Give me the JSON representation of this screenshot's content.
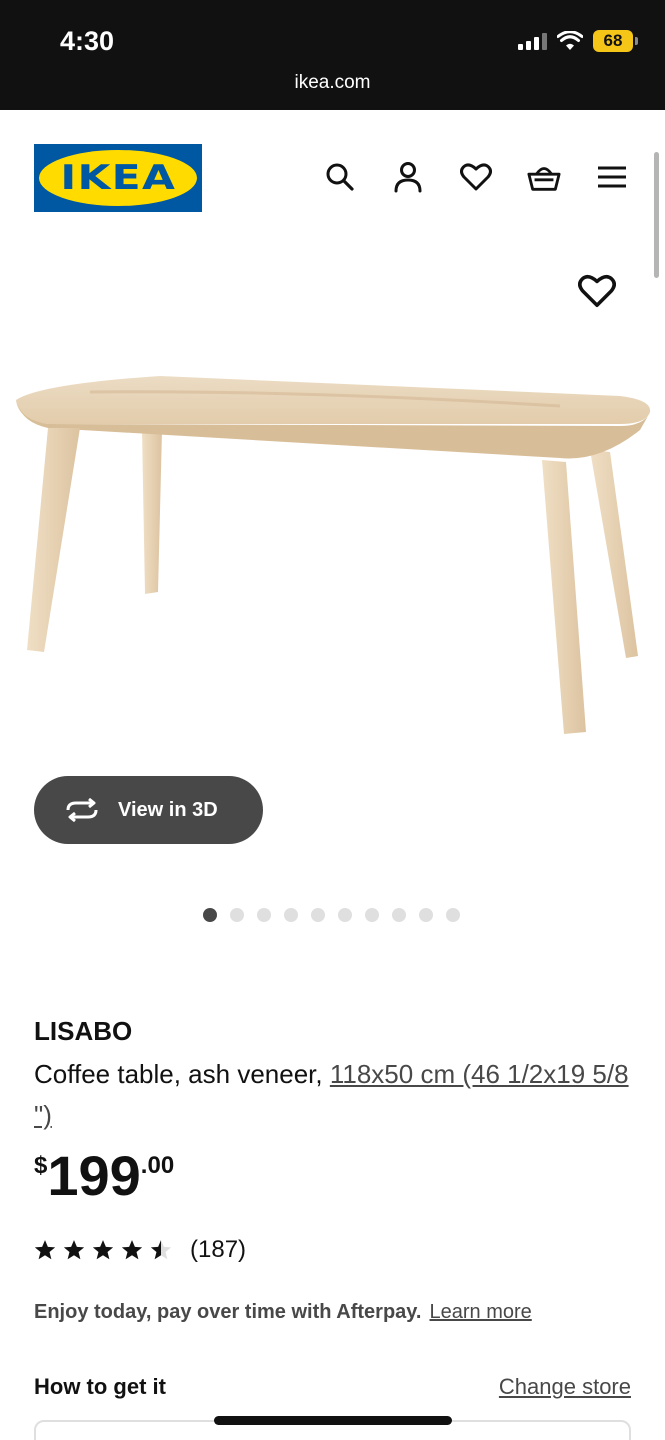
{
  "status_bar": {
    "time": "4:30",
    "battery": "68",
    "url": "ikea.com"
  },
  "header": {
    "logo_text": "IKEA",
    "icons": [
      "search-icon",
      "account-icon",
      "heart-icon",
      "basket-icon",
      "menu-icon"
    ]
  },
  "gallery": {
    "view3d_label": "View in 3D",
    "dots_total": 10,
    "active_dot": 1
  },
  "product": {
    "name": "LISABO",
    "description": "Coffee table, ash veneer, ",
    "size_link": "118x50 cm (46 1/2x19 5/8 \")",
    "price_currency": "$",
    "price_integer": "199",
    "price_decimal": ".00",
    "rating_value": 4.5,
    "rating_max": 5,
    "rating_count": "(187)"
  },
  "afterpay": {
    "message": "Enjoy today, pay over time with Afterpay.",
    "link": "Learn more"
  },
  "delivery": {
    "heading": "How to get it",
    "change_store": "Change store"
  },
  "colors": {
    "ikea_blue": "#0058a3",
    "ikea_yellow": "#ffdb00",
    "dark_button": "#484848"
  }
}
